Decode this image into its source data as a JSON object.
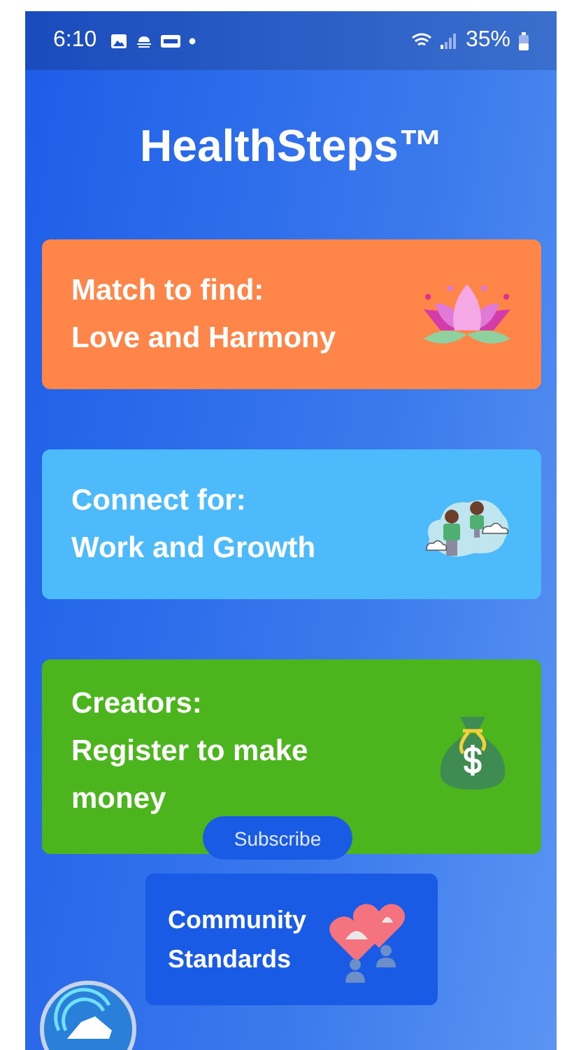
{
  "status_bar": {
    "time": "6:10",
    "battery": "35%"
  },
  "title": "HealthSteps™",
  "cards": [
    {
      "kind": "lotus",
      "color": "#ff8549",
      "lines": [
        "Match to find:",
        "Love and Harmony"
      ]
    },
    {
      "kind": "people",
      "color": "#4dbbfb",
      "lines": [
        "Connect for:",
        "Work and Growth"
      ]
    },
    {
      "kind": "money",
      "color": "#4cb51e",
      "lines": [
        "Creators:",
        "Register to make",
        "money"
      ]
    }
  ],
  "subscribe": "Subscribe",
  "community": {
    "lines": [
      "Community",
      "Standards"
    ]
  }
}
